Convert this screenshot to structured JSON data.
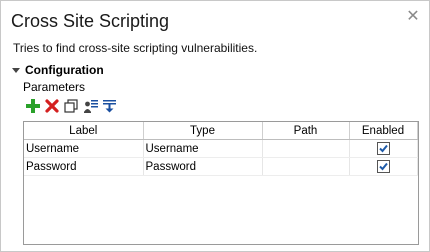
{
  "title": "Cross Site Scripting",
  "description": "Tries to find cross-site scripting vulnerabilities.",
  "section": {
    "label": "Configuration",
    "expanded": true
  },
  "parameters_label": "Parameters",
  "toolbar": [
    {
      "name": "add-icon",
      "color": "#2aa12a"
    },
    {
      "name": "delete-icon",
      "color": "#d42020"
    },
    {
      "name": "copy-icon",
      "color": "#333333"
    },
    {
      "name": "edit-list-icon",
      "color": "#333333"
    },
    {
      "name": "sort-down-icon",
      "color": "#1a4fa0"
    }
  ],
  "table": {
    "columns": [
      "Label",
      "Type",
      "Path",
      "Enabled"
    ],
    "rows": [
      {
        "label": "Username",
        "type": "Username",
        "path": "",
        "enabled": true
      },
      {
        "label": "Password",
        "type": "Password",
        "path": "",
        "enabled": true
      }
    ]
  },
  "colors": {
    "checkmark": "#1e5aa8",
    "border": "#9a9a9a"
  }
}
